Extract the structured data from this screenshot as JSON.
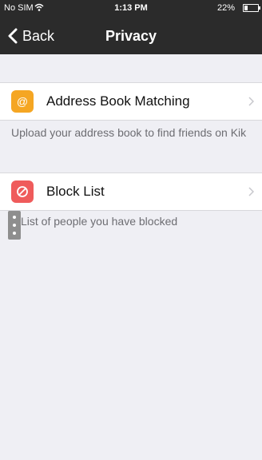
{
  "status_bar": {
    "carrier": "No SIM",
    "time": "1:13 PM",
    "battery_percent": "22%",
    "battery_level": 0.22,
    "wifi_icon": "wifi-icon"
  },
  "nav": {
    "back_label": "Back",
    "title": "Privacy",
    "background_color": "#2b2b2b"
  },
  "sections": [
    {
      "label": "Address Book Matching",
      "icon": "at-sign-icon",
      "icon_color": "#f5a623",
      "description": "Upload your address book to find friends on Kik"
    },
    {
      "label": "Block List",
      "icon": "block-icon",
      "icon_color": "#ef5b5b",
      "description": "List of people you have blocked"
    }
  ],
  "side_handle_icon": "drag-handle-icon"
}
